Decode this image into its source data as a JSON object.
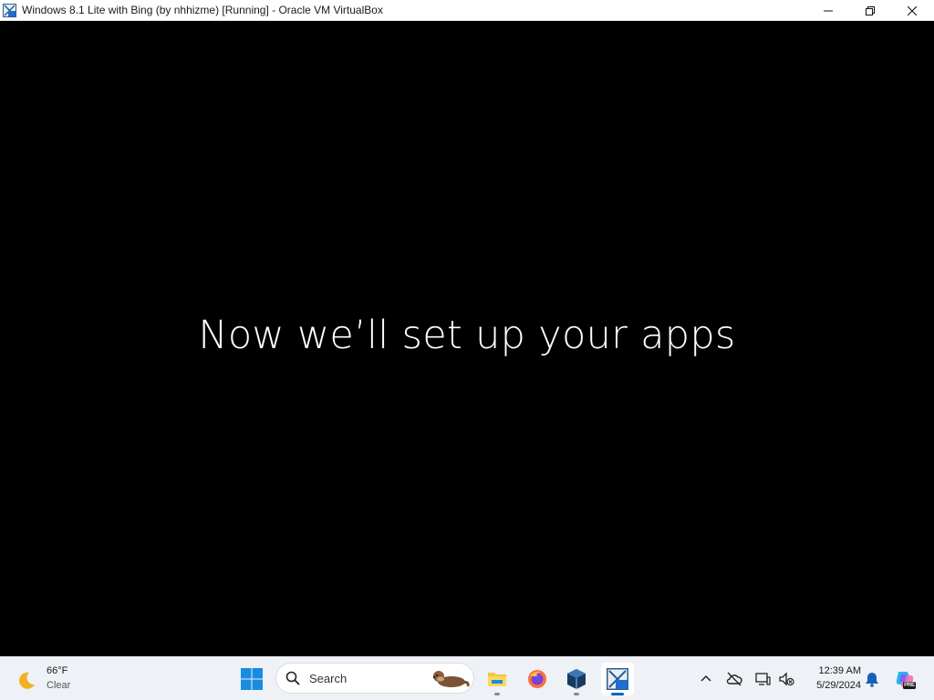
{
  "window": {
    "title": "Windows 8.1 Lite with Bing (by nhhizme) [Running] - Oracle VM VirtualBox",
    "icon": "virtualbox-vm-icon",
    "controls": [
      "minimize-icon",
      "restore-icon",
      "close-icon"
    ]
  },
  "vm_screen": {
    "message": "Now we’ll set up your apps",
    "background": "#000000"
  },
  "taskbar": {
    "weather": {
      "temperature": "66°F",
      "condition": "Clear",
      "icon": "moon-icon"
    },
    "search": {
      "label": "Search",
      "icon": "search-icon"
    },
    "pinned_apps": [
      {
        "name": "File Explorer",
        "icon": "folder-icon",
        "running": true
      },
      {
        "name": "Firefox",
        "icon": "firefox-icon",
        "running": false
      },
      {
        "name": "Oracle VM VirtualBox",
        "icon": "virtualbox-icon",
        "running": true
      },
      {
        "name": "Windows 8.1 VM",
        "icon": "virtualbox-vm-icon",
        "running": true,
        "active": true
      }
    ],
    "tray": {
      "icons": [
        "chevron-up-icon",
        "cloud-offline-icon",
        "display-icon",
        "volume-muted-icon"
      ],
      "time": "12:39 AM",
      "date": "5/29/2024",
      "notification_icon": "bell-icon",
      "copilot_badge": "PRE"
    }
  },
  "colors": {
    "taskbar_bg": "#eef1f6",
    "accent": "#0067c0",
    "screen_bg": "#000000",
    "text_on_screen": "#ffffff"
  }
}
